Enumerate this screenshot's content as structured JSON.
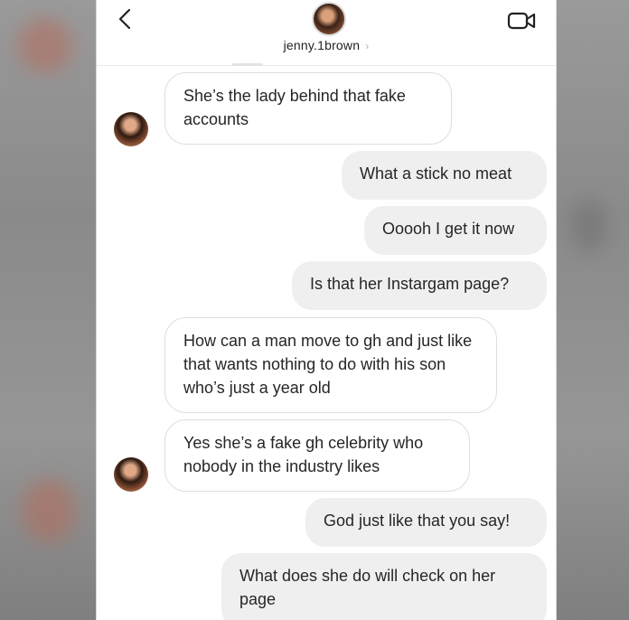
{
  "header": {
    "username": "jenny.1brown",
    "back_icon": "chevron-left-icon",
    "video_icon": "video-camera-icon"
  },
  "messages": [
    {
      "side": "received",
      "text": "She’s the lady behind that fake accounts"
    },
    {
      "side": "sent",
      "text": "What a stick no meat"
    },
    {
      "side": "sent",
      "text": "Ooooh I get it now"
    },
    {
      "side": "sent",
      "text": "Is that her Instargam page?"
    },
    {
      "side": "received",
      "text": "How can a man move to gh and just like that wants nothing to do with his son who’s just a year old"
    },
    {
      "side": "received",
      "text": "Yes she’s a fake gh celebrity who nobody in the industry likes"
    },
    {
      "side": "sent",
      "text": "God just like that you say!"
    },
    {
      "side": "sent",
      "text": "What does she do will check on her page"
    }
  ],
  "colors": {
    "sent_bubble": "#efefef",
    "received_bubble": "#ffffff",
    "text": "#262626"
  }
}
